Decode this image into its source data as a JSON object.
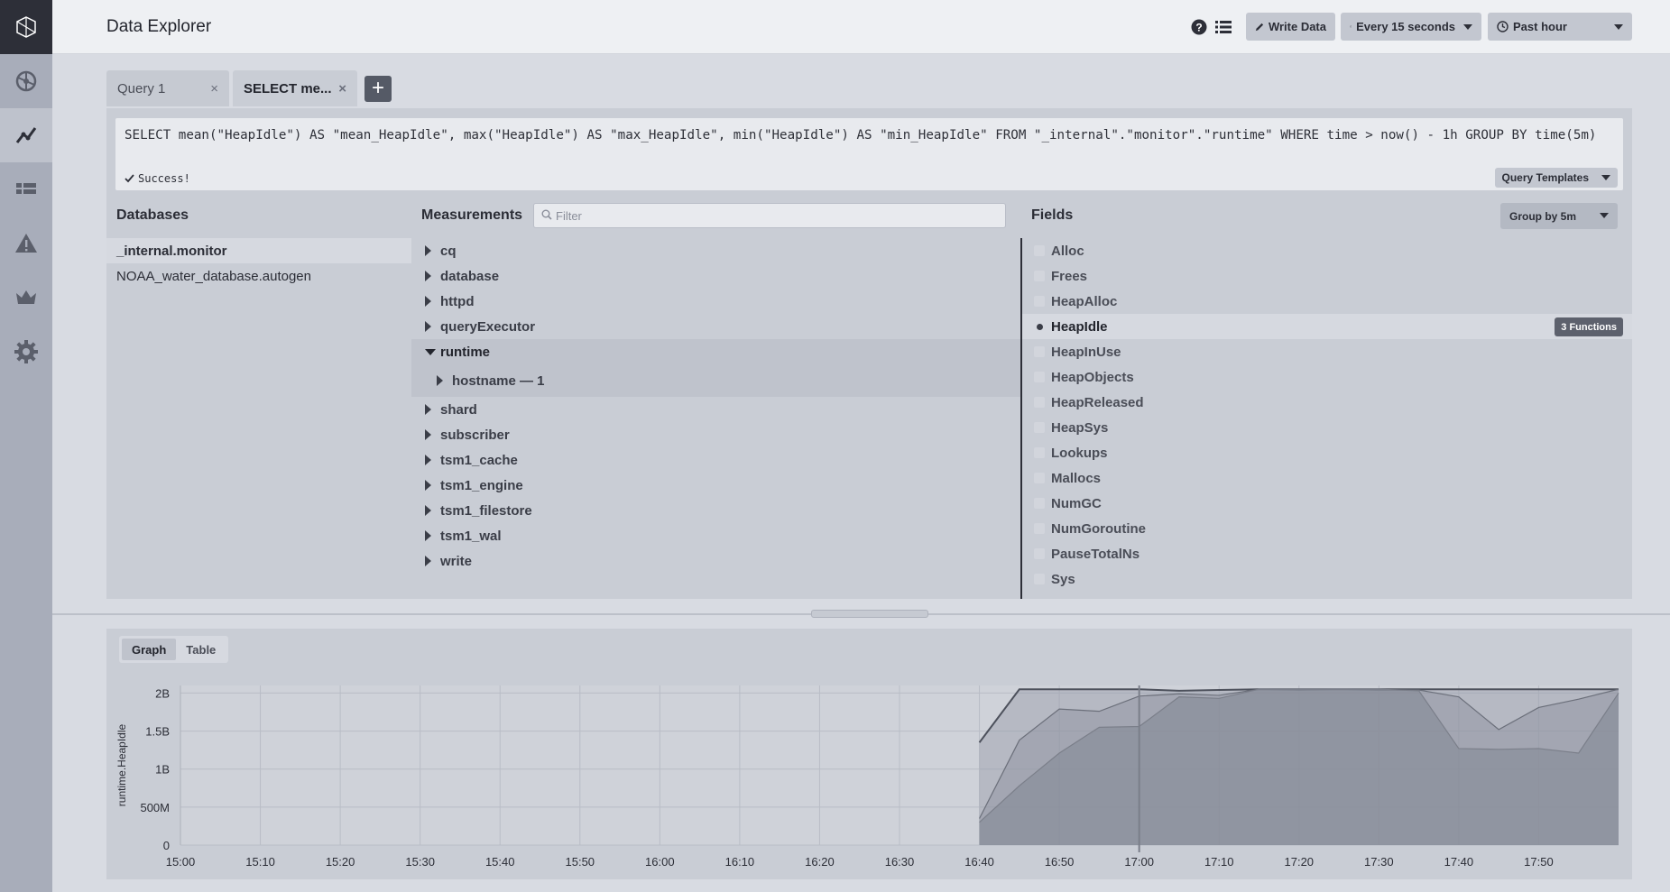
{
  "header": {
    "title": "Data Explorer",
    "write_data": "Write Data",
    "refresh": "Every 15 seconds",
    "time_range": "Past hour"
  },
  "tabs": [
    {
      "label": "Query 1",
      "close": "×"
    },
    {
      "label": "SELECT me...",
      "close": "×"
    }
  ],
  "add_tab": "+",
  "editor": {
    "query": "SELECT mean(\"HeapIdle\") AS \"mean_HeapIdle\", max(\"HeapIdle\") AS \"max_HeapIdle\", min(\"HeapIdle\") AS \"min_HeapIdle\" FROM \"_internal\".\"monitor\".\"runtime\" WHERE time > now() - 1h GROUP BY time(5m)",
    "status": "Success!",
    "templates_label": "Query Templates"
  },
  "databases": {
    "heading": "Databases",
    "items": [
      "_internal.monitor",
      "NOAA_water_database.autogen"
    ]
  },
  "measurements": {
    "heading": "Measurements",
    "filter_placeholder": "Filter",
    "items": [
      "cq",
      "database",
      "httpd",
      "queryExecutor",
      "runtime",
      "shard",
      "subscriber",
      "tsm1_cache",
      "tsm1_engine",
      "tsm1_filestore",
      "tsm1_wal",
      "write"
    ],
    "expanded_tag": "hostname — 1"
  },
  "fields": {
    "heading": "Fields",
    "group_by": "Group by 5m",
    "items": [
      "Alloc",
      "Frees",
      "HeapAlloc",
      "HeapIdle",
      "HeapInUse",
      "HeapObjects",
      "HeapReleased",
      "HeapSys",
      "Lookups",
      "Mallocs",
      "NumGC",
      "NumGoroutine",
      "PauseTotalNs",
      "Sys"
    ],
    "functions_badge": "3 Functions"
  },
  "view_tabs": {
    "graph": "Graph",
    "table": "Table"
  },
  "chart_data": {
    "type": "area",
    "ylabel": "runtime.HeapIdle",
    "y_ticks": [
      "0",
      "500M",
      "1B",
      "1.5B",
      "2B"
    ],
    "ylim": [
      0,
      2100000000
    ],
    "x_ticks": [
      "15:00",
      "15:10",
      "15:20",
      "15:30",
      "15:40",
      "15:50",
      "16:00",
      "16:10",
      "16:20",
      "16:30",
      "16:40",
      "16:50",
      "17:00",
      "17:10",
      "17:20",
      "17:30",
      "17:40",
      "17:50"
    ],
    "x": [
      "16:40",
      "16:45",
      "16:50",
      "16:55",
      "17:00",
      "17:05",
      "17:10",
      "17:15",
      "17:20",
      "17:25",
      "17:30",
      "17:35",
      "17:40",
      "17:45",
      "17:50",
      "17:55",
      "18:00"
    ],
    "series": [
      {
        "values": [
          1350000000,
          2050000000,
          2050000000,
          2050000000,
          2050000000,
          2030000000,
          2040000000,
          2050000000,
          2050000000,
          2050000000,
          2050000000,
          2050000000,
          2050000000,
          2050000000,
          2050000000,
          2050000000,
          2050000000
        ]
      },
      {
        "values": [
          350000000,
          1380000000,
          1790000000,
          1760000000,
          1960000000,
          1990000000,
          1970000000,
          2050000000,
          2040000000,
          2050000000,
          2040000000,
          2040000000,
          1950000000,
          1520000000,
          1810000000,
          1920000000,
          2050000000
        ]
      },
      {
        "values": [
          300000000,
          780000000,
          1210000000,
          1550000000,
          1560000000,
          1950000000,
          1930000000,
          2050000000,
          2050000000,
          2050000000,
          2050000000,
          2030000000,
          1270000000,
          1260000000,
          1270000000,
          1210000000,
          2000000000
        ]
      }
    ]
  }
}
